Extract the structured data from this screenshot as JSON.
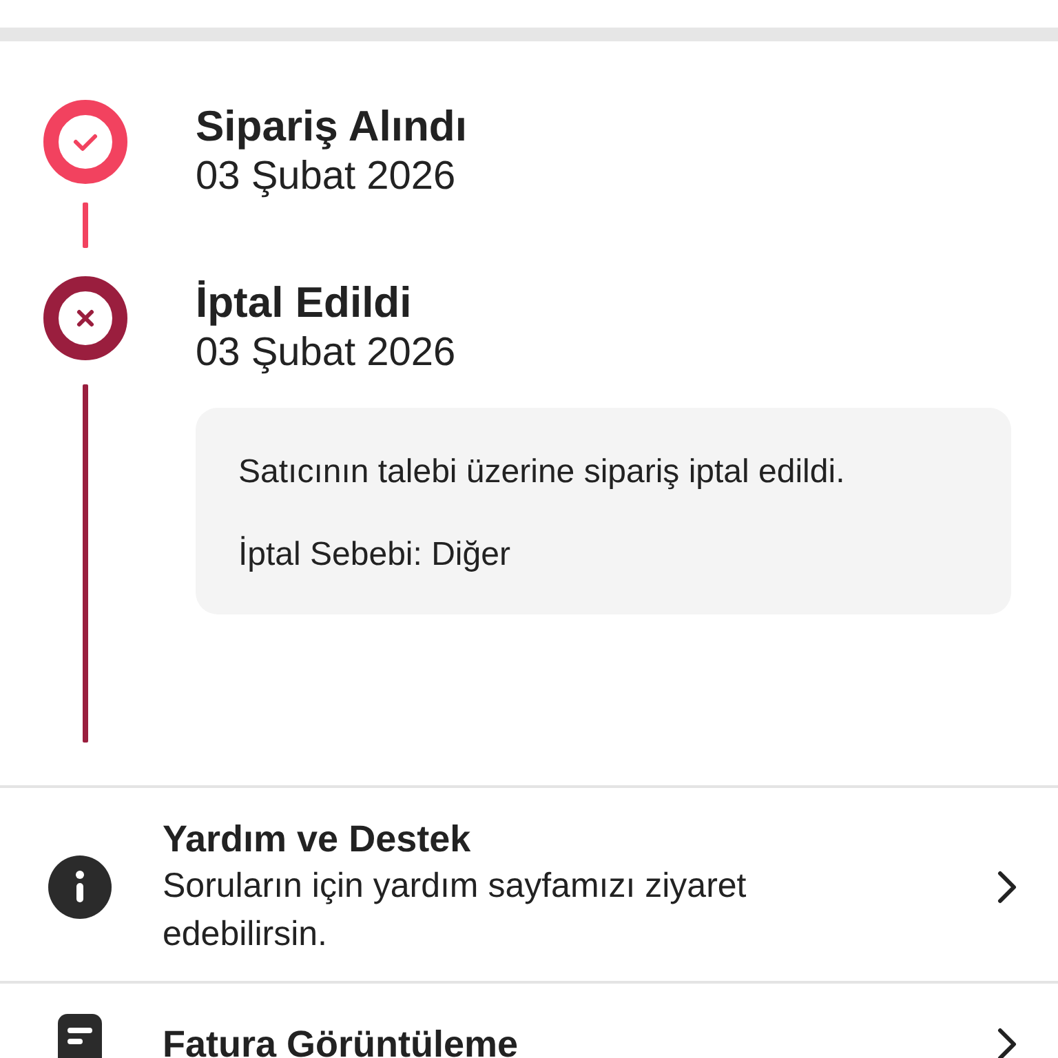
{
  "timeline": [
    {
      "kind": "done",
      "title": "Sipariş Alındı",
      "date": "03 Şubat 2026"
    },
    {
      "kind": "cancelled",
      "title": "İptal Edildi",
      "date": "03 Şubat 2026",
      "note": {
        "message": "Satıcının talebi üzerine sipariş iptal edildi.",
        "reason": "İptal Sebebi: Diğer"
      }
    }
  ],
  "menu": [
    {
      "kind": "info",
      "title": "Yardım ve Destek",
      "description": "Soruların için yardım sayfamızı ziyaret edebilirsin."
    },
    {
      "kind": "document",
      "title": "Fatura Görüntüleme"
    }
  ]
}
